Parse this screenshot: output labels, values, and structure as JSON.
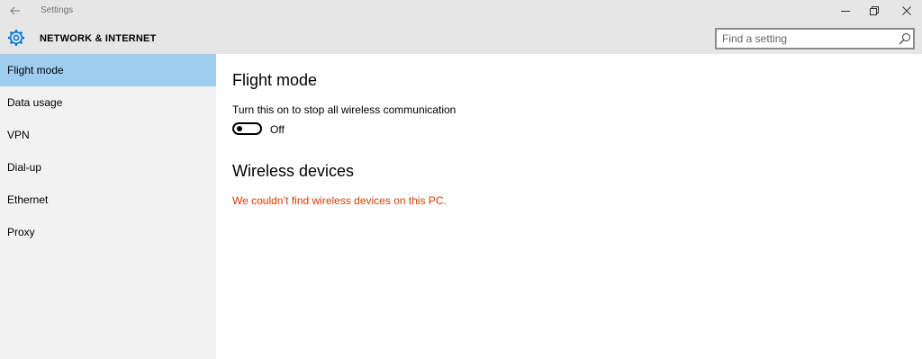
{
  "window": {
    "title": "Settings",
    "back_icon": "arrow-left-icon",
    "controls": [
      "minimize-icon",
      "restore-icon",
      "close-icon"
    ]
  },
  "header": {
    "icon": "gear-icon",
    "title": "NETWORK & INTERNET",
    "search": {
      "placeholder": "Find a setting",
      "value": "",
      "icon": "search-icon"
    }
  },
  "sidebar": {
    "selected": "Flight mode",
    "items": [
      {
        "label": "Flight mode"
      },
      {
        "label": "Data usage"
      },
      {
        "label": "VPN"
      },
      {
        "label": "Dial-up"
      },
      {
        "label": "Ethernet"
      },
      {
        "label": "Proxy"
      }
    ]
  },
  "main": {
    "flight_mode": {
      "heading": "Flight mode",
      "description": "Turn this on to stop all wireless communication",
      "toggle_on": false,
      "toggle_state": "Off"
    },
    "wireless": {
      "heading": "Wireless devices",
      "message": "We couldn’t find wireless devices on this PC."
    }
  },
  "colors": {
    "accent": "#0078d7",
    "selected_background": "#9fcdf0",
    "error": "#d83b01",
    "header_background": "#e6e6e6",
    "sidebar_background": "#f2f2f2"
  }
}
